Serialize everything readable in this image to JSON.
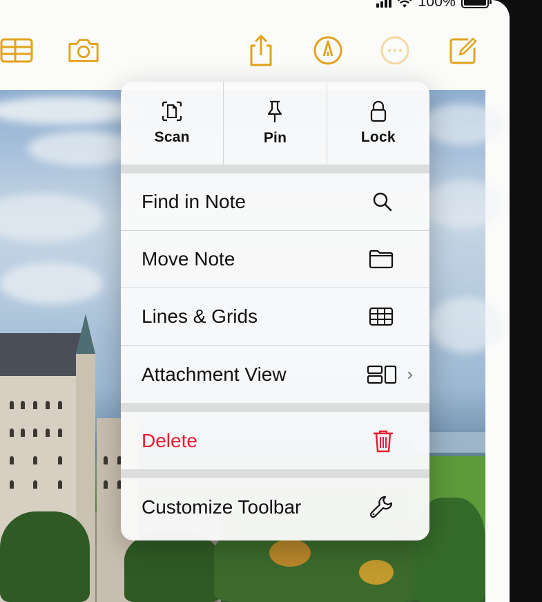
{
  "status_bar": {
    "battery_percent": "100%"
  },
  "toolbar": {
    "buttons": [
      {
        "icon": "table-icon"
      },
      {
        "icon": "camera-icon"
      },
      {
        "icon": "share-icon"
      },
      {
        "icon": "markup-pen-icon"
      },
      {
        "icon": "more-ellipsis-icon"
      },
      {
        "icon": "compose-icon"
      }
    ],
    "accent_color": "#e3a21a"
  },
  "menu": {
    "quick_actions": [
      {
        "label": "Scan",
        "icon": "scan-document-icon"
      },
      {
        "label": "Pin",
        "icon": "pin-icon"
      },
      {
        "label": "Lock",
        "icon": "lock-icon"
      }
    ],
    "items": [
      {
        "label": "Find in Note",
        "icon": "search-icon"
      },
      {
        "label": "Move Note",
        "icon": "folder-icon"
      },
      {
        "label": "Lines & Grids",
        "icon": "grid-icon"
      },
      {
        "label": "Attachment View",
        "icon": "attachment-view-icon",
        "chevron": "›"
      },
      {
        "label": "Delete",
        "icon": "trash-icon",
        "color": "#e8192c"
      },
      {
        "label": "Customize Toolbar",
        "icon": "wrench-icon"
      }
    ]
  }
}
